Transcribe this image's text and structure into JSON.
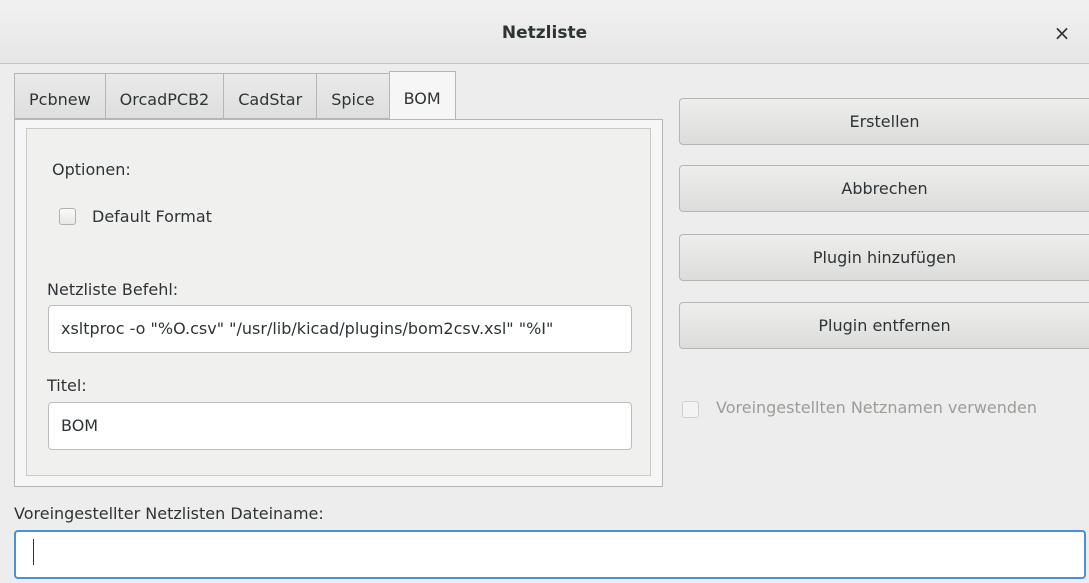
{
  "window": {
    "title": "Netzliste",
    "close_symbol": "×"
  },
  "tabs": [
    {
      "label": "Pcbnew"
    },
    {
      "label": "OrcadPCB2"
    },
    {
      "label": "CadStar"
    },
    {
      "label": "Spice"
    },
    {
      "label": "BOM"
    }
  ],
  "active_tab": "BOM",
  "options": {
    "heading": "Optionen:",
    "default_format_label": "Default Format",
    "default_format_checked": false
  },
  "command": {
    "label": "Netzliste Befehl:",
    "value": "xsltproc -o \"%O.csv\" \"/usr/lib/kicad/plugins/bom2csv.xsl\" \"%I\""
  },
  "titel": {
    "label": "Titel:",
    "value": "BOM"
  },
  "buttons": {
    "create": "Erstellen",
    "cancel": "Abbrechen",
    "add_plugin": "Plugin hinzufügen",
    "remove_plugin": "Plugin entfernen"
  },
  "use_default_netnames": {
    "label": "Voreingestellten Netznamen verwenden",
    "checked": false,
    "enabled": false
  },
  "filename": {
    "label": "Voreingestellter Netzlisten Dateiname:",
    "value": ""
  },
  "colors": {
    "focus": "#4a90d9",
    "window_bg": "#ededed"
  }
}
